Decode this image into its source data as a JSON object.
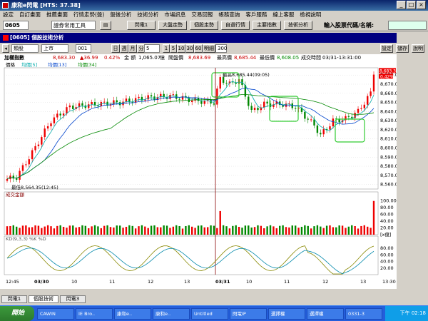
{
  "window": {
    "title": "康和e閃電  [HTS: 37.38]"
  },
  "menu": [
    "設定",
    "自訂畫面",
    "推薦畫面",
    "行情走勢(盤)",
    "盤後分析",
    "技術分析",
    "市場訊息",
    "交易回報",
    "帳務查詢",
    "客戶服務",
    "線上客服",
    "檢視說明"
  ],
  "toolbar": {
    "code": "0605",
    "tool_label": "證券常用工具",
    "btn1": "閃電1",
    "btn2": "大盤走勢",
    "btn3": "個股走勢",
    "btn4": "自選行情",
    "btn5": "主要指數",
    "btn6": "技術分析",
    "search_label": "輸入股票代碼/名稱:"
  },
  "chart_window": {
    "title": "[0605] 個股技術分析",
    "ctrl1": "類股",
    "ctrl2": "上市",
    "ctrl3": "001",
    "periods": [
      "日",
      "週",
      "月",
      "分"
    ],
    "count": "5",
    "mins": [
      "1",
      "5",
      "10",
      "30",
      "60"
    ],
    "ticks": "明細",
    "set_label": "設定",
    "add_label": "儲存",
    "help_label": "說明"
  },
  "info": {
    "name": "加權指數",
    "price": "8,683.30",
    "chg": "▲36.99",
    "pct": "0.42%",
    "amt_label": "金 額",
    "amount": "1,065.07",
    "unit": "億",
    "open_label": "開盤價",
    "open": "8,683.69",
    "high_label": "最高價",
    "high": "8,685.44",
    "low_label": "最低價",
    "low": "8,608.05",
    "time_label": "成交時間",
    "time": "03/31-13:31:00"
  },
  "chart_data": [
    {
      "type": "line",
      "legend": [
        "價格",
        "均價[5]",
        "均價[13]",
        "均價[34]"
      ],
      "y_ticks": [
        "8,680.00",
        "8,670.00",
        "8,660.00",
        "8,650.00",
        "8,640.00",
        "8,630.00",
        "8,620.00",
        "8,610.00",
        "8,600.00",
        "8,590.00",
        "8,580.00",
        "8,570.00",
        "8,560.00"
      ],
      "ylim": [
        8555,
        8688
      ],
      "high_label": "最高8,685.44(09:05)",
      "low_label": "最低8,564.35(12:45)",
      "last_price": "8,683.30",
      "last_pct": "0.42%",
      "colors": {
        "ma5": "#00aaaa",
        "ma13": "#0044cc",
        "ma34": "#008800"
      }
    },
    {
      "type": "bar",
      "title": "成交金額",
      "y_ticks": [
        "100.00",
        "80.00",
        "60.00",
        "40.00",
        "20.00"
      ],
      "unit": "[x億]",
      "ylim": [
        0,
        110
      ]
    },
    {
      "type": "line",
      "title": "KD(9,3,3) %K %D",
      "y_ticks": [
        "80.00",
        "60.00",
        "40.00",
        "20.00"
      ],
      "ylim": [
        0,
        100
      ]
    }
  ],
  "x_ticks": [
    "12:45",
    "03/30",
    "10",
    "11",
    "12",
    "13",
    "03/31",
    "10",
    "11",
    "12",
    "13",
    "13:30"
  ],
  "tabs": [
    "閃電1",
    "個股技術",
    "閃電3"
  ],
  "taskbar": {
    "start": "開始",
    "items": [
      "CAWIN",
      "IE Bro..",
      "康和e..",
      "康和e..",
      "Untitled",
      "閃電IP",
      "選擇權",
      "選擇權",
      "0331-3"
    ],
    "clock": "下午 02:18"
  }
}
